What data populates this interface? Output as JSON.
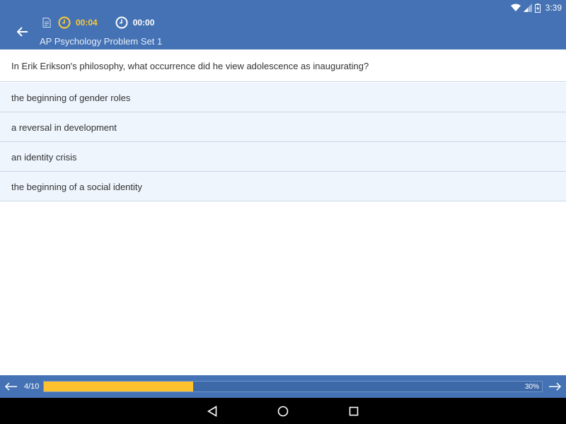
{
  "status_bar": {
    "time": "3:39"
  },
  "header": {
    "timer_elapsed": "00:04",
    "timer_total": "00:00",
    "subtitle": "AP Psychology Problem Set 1"
  },
  "question": {
    "text": "In Erik Erikson's philosophy, what occurrence did he view adolescence as inaugurating?",
    "answers": [
      "the beginning of gender roles",
      "a reversal in development",
      "an identity crisis",
      "the beginning of a social identity"
    ]
  },
  "progress": {
    "count": "4/10",
    "percent_label": "30%",
    "fraction": 0.3
  },
  "colors": {
    "header_blue": "#4472b4",
    "accent_yellow": "#ffc12e",
    "answer_bg": "#eef5fd"
  }
}
